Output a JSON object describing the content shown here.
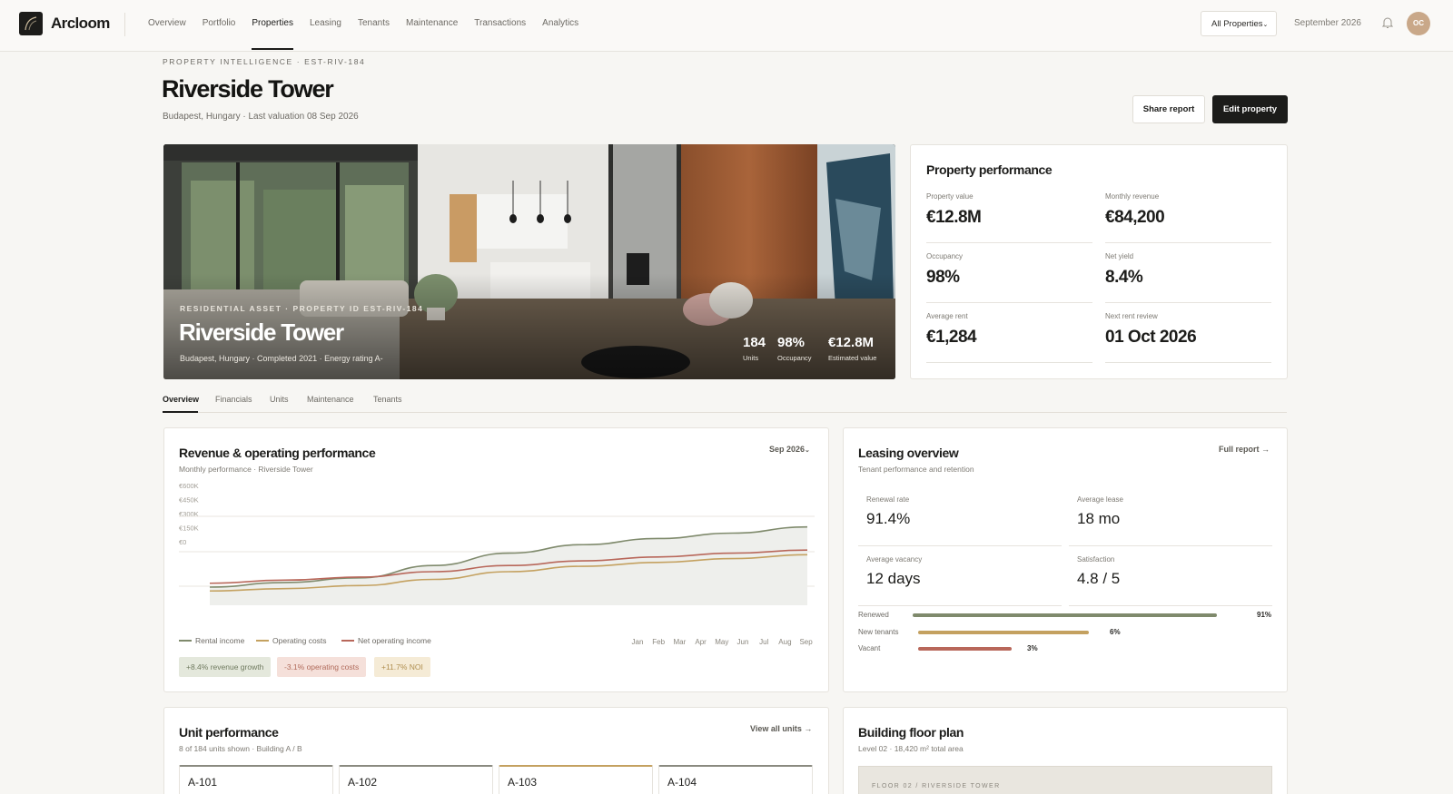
{
  "app": {
    "name": "Arcloom",
    "avatar_initials": "OC",
    "date_label": "September 2026",
    "property_filter": "All Properties"
  },
  "nav": [
    {
      "label": "Overview"
    },
    {
      "label": "Portfolio"
    },
    {
      "label": "Properties",
      "active": true
    },
    {
      "label": "Leasing"
    },
    {
      "label": "Tenants"
    },
    {
      "label": "Maintenance"
    },
    {
      "label": "Transactions"
    },
    {
      "label": "Analytics"
    }
  ],
  "header": {
    "eyebrow": "PROPERTY INTELLIGENCE · EST-RIV-184",
    "title": "Riverside Tower",
    "subtitle": "Budapest, Hungary · Last valuation 08 Sep 2026",
    "share_label": "Share report",
    "edit_label": "Edit property"
  },
  "hero": {
    "eyebrow": "RESIDENTIAL ASSET · PROPERTY ID EST-RIV-184",
    "title": "Riverside Tower",
    "subtitle": "Budapest, Hungary · Completed 2021 · Energy rating A-",
    "stats": [
      {
        "value": "184",
        "label": "Units"
      },
      {
        "value": "98%",
        "label": "Occupancy"
      },
      {
        "value": "€12.8M",
        "label": "Estimated value"
      }
    ]
  },
  "performance": {
    "title": "Property performance",
    "metrics": [
      {
        "label": "Property value",
        "value": "€12.8M"
      },
      {
        "label": "Monthly revenue",
        "value": "€84,200"
      },
      {
        "label": "Occupancy",
        "value": "98%"
      },
      {
        "label": "Net yield",
        "value": "8.4%"
      },
      {
        "label": "Average rent",
        "value": "€1,284"
      },
      {
        "label": "Next rent review",
        "value": "01 Oct 2026"
      }
    ]
  },
  "tabs": [
    {
      "label": "Overview",
      "active": true
    },
    {
      "label": "Financials"
    },
    {
      "label": "Units"
    },
    {
      "label": "Maintenance"
    },
    {
      "label": "Tenants"
    }
  ],
  "revenue": {
    "title": "Revenue & operating performance",
    "subtitle": "Monthly performance · Riverside Tower",
    "period": "Sep 2026",
    "badges": [
      "+8.4% revenue growth",
      "-3.1% operating costs",
      "+11.7% NOI"
    ],
    "colors": {
      "rental": "#7f8a6c",
      "costs": "#c4a160",
      "noi": "#b8675a"
    }
  },
  "chart_data": {
    "type": "line",
    "categories": [
      "Jan",
      "Feb",
      "Mar",
      "Apr",
      "May",
      "Jun",
      "Jul",
      "Aug",
      "Sep"
    ],
    "y_ticks": [
      "€600K",
      "€450K",
      "€300K",
      "€150K",
      "€0"
    ],
    "series": [
      {
        "name": "Rental income",
        "values": [
          0.0,
          0.06,
          0.12,
          0.28,
          0.44,
          0.55,
          0.63,
          0.7,
          0.78
        ]
      },
      {
        "name": "Operating costs",
        "values": [
          -0.05,
          -0.02,
          0.02,
          0.1,
          0.2,
          0.27,
          0.32,
          0.37,
          0.42
        ]
      },
      {
        "name": "Net operating income",
        "values": [
          0.05,
          0.09,
          0.13,
          0.2,
          0.28,
          0.34,
          0.39,
          0.44,
          0.48
        ]
      }
    ],
    "legend": "bottom-left",
    "grid": true
  },
  "leasing": {
    "title": "Leasing overview",
    "subtitle": "Tenant performance and retention",
    "link": "Full report →",
    "metrics": [
      {
        "label": "Renewal rate",
        "value": "91.4%"
      },
      {
        "label": "Average lease",
        "value": "18 mo"
      },
      {
        "label": "Average vacancy",
        "value": "12 days"
      },
      {
        "label": "Satisfaction",
        "value": "4.8 / 5"
      }
    ],
    "bars": [
      {
        "label": "Renewed",
        "value": "91%",
        "fraction": 0.91,
        "color": "#7f8a6c"
      },
      {
        "label": "New tenants",
        "value": "6%",
        "fraction": 0.51,
        "color": "#c4a160"
      },
      {
        "label": "Vacant",
        "value": "3%",
        "fraction": 0.28,
        "color": "#b8675a"
      }
    ]
  },
  "units": {
    "title": "Unit performance",
    "subtitle": "8 of 184 units shown · Building A / B",
    "link": "View all units →",
    "items": [
      "A-101",
      "A-102",
      "A-103",
      "A-104"
    ]
  },
  "floor": {
    "title": "Building floor plan",
    "subtitle": "Level 02 · 18,420 m² total area",
    "plan_label": "FLOOR 02 / RIVERSIDE TOWER"
  }
}
